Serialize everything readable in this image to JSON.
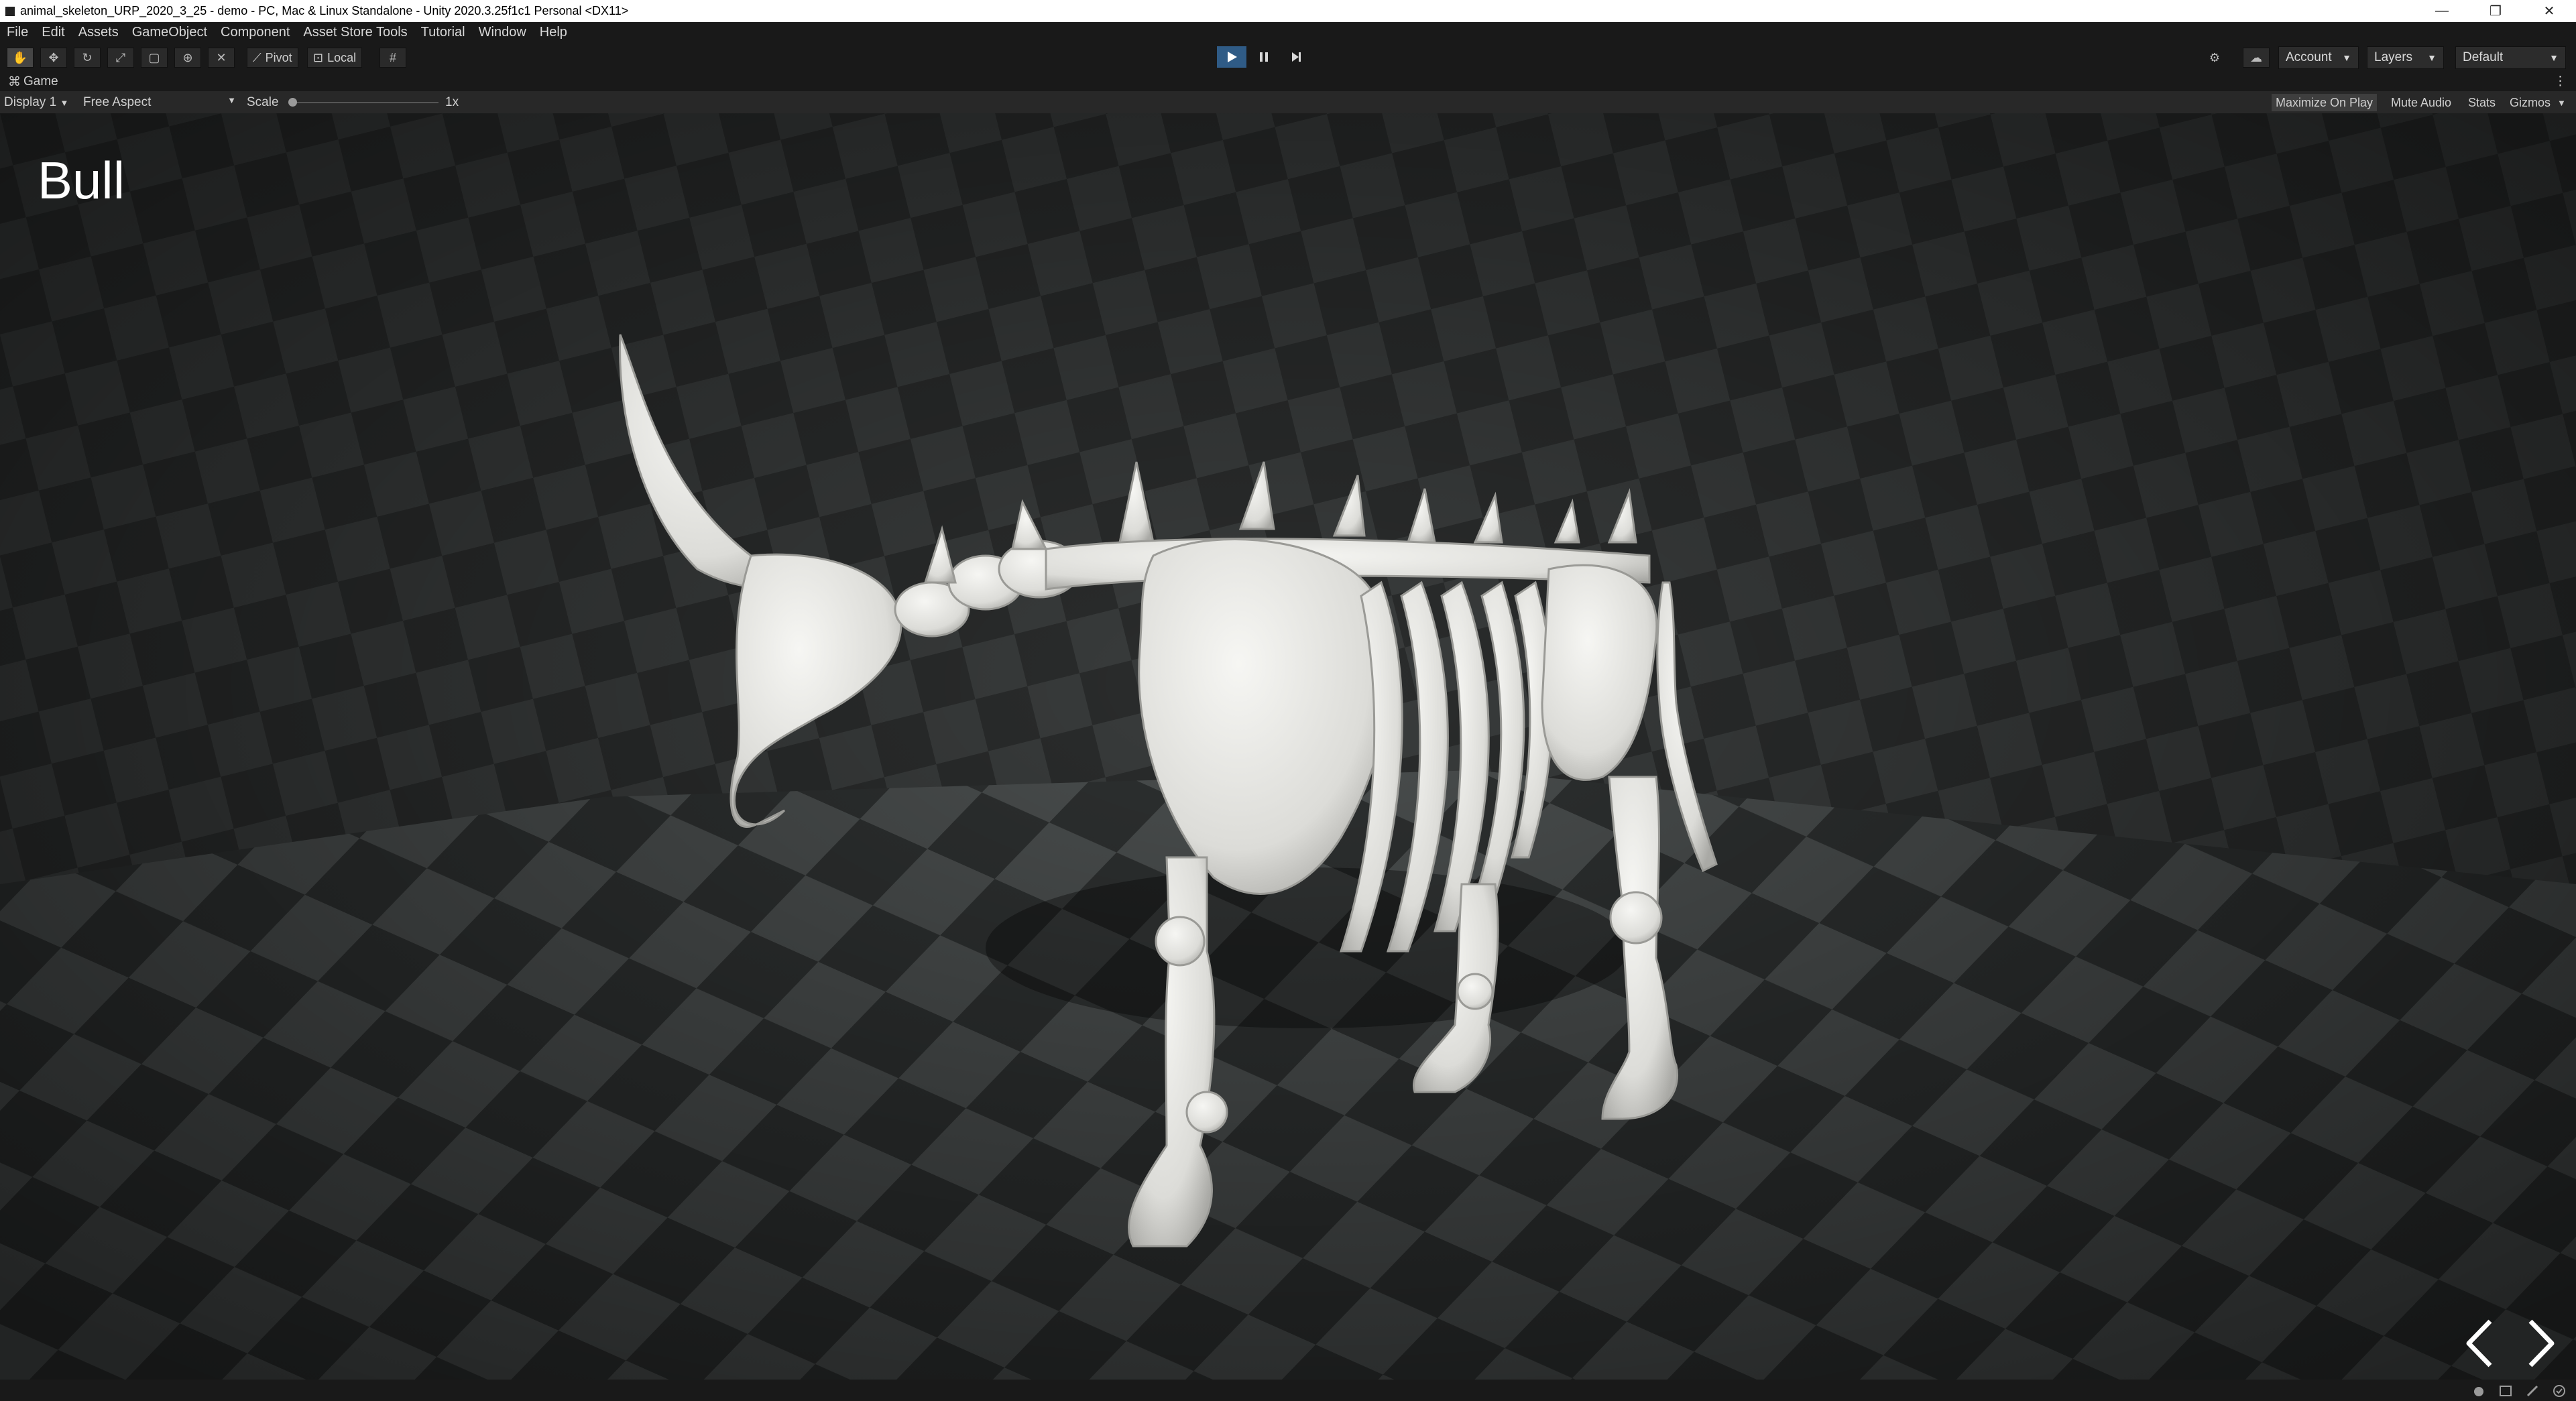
{
  "window": {
    "title": "animal_skeleton_URP_2020_3_25 - demo - PC, Mac & Linux Standalone - Unity 2020.3.25f1c1 Personal <DX11>",
    "minimize": "—",
    "restore": "❐",
    "close": "✕"
  },
  "menu": [
    "File",
    "Edit",
    "Assets",
    "GameObject",
    "Component",
    "Asset Store Tools",
    "Tutorial",
    "Window",
    "Help"
  ],
  "toolbar": {
    "pivot_label": "Pivot",
    "local_label": "Local",
    "account_label": "Account",
    "layers_label": "Layers",
    "layout_label": "Default",
    "play_state": "playing"
  },
  "game_tab": {
    "label": "Game"
  },
  "game_bar": {
    "display": "Display 1",
    "aspect": "Free Aspect",
    "scale_label": "Scale",
    "scale_value": "1x",
    "maximize": "Maximize On Play",
    "mute": "Mute Audio",
    "stats": "Stats",
    "gizmos": "Gizmos"
  },
  "scene": {
    "title": "Bull",
    "subject": "bull skeleton",
    "floor_colors": {
      "dark": "#2d2f2f",
      "light": "#4a4d4d"
    },
    "bone_color": "#e6e6e2"
  },
  "icons": {
    "prev": "chevron-left-icon",
    "next": "chevron-right-icon",
    "play": "play-icon",
    "pause": "pause-icon",
    "step": "step-icon"
  }
}
